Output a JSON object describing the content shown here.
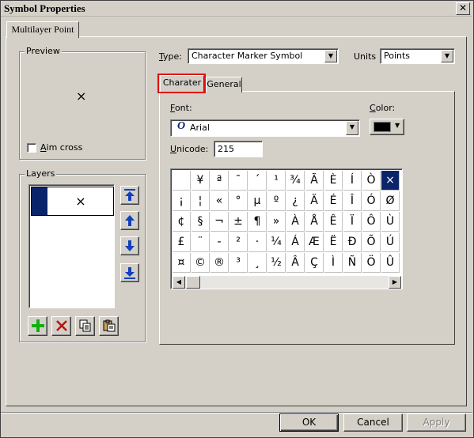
{
  "window": {
    "title": "Symbol Properties",
    "close_glyph": "✕"
  },
  "outer_tab": {
    "label": "Multilayer Point"
  },
  "preview": {
    "label": "Preview",
    "glyph": "×",
    "aim_cross_label": "Aim cross",
    "aim_cross_checked": false
  },
  "layers": {
    "label": "Layers",
    "items": [
      {
        "glyph": "×",
        "swatch_color": "#0a246a"
      }
    ],
    "move_buttons": [
      "move-to-top-icon",
      "move-up-icon",
      "move-down-icon",
      "move-to-bottom-icon"
    ],
    "tool_buttons": [
      "add-icon",
      "delete-icon",
      "copy-icon",
      "paste-icon"
    ]
  },
  "type": {
    "label": "Type:",
    "value": "Character Marker Symbol"
  },
  "units": {
    "label": "Units",
    "value": "Points"
  },
  "inner_tabs": [
    {
      "label": "Charater",
      "active": true
    },
    {
      "label": "General",
      "active": false
    }
  ],
  "font": {
    "label": "Font:",
    "value": "Arial",
    "icon": "opentype-font-icon"
  },
  "color": {
    "label": "Color:",
    "swatch": "#000000"
  },
  "unicode": {
    "label": "Unicode:",
    "value": "215"
  },
  "char_grid": {
    "selected": "×",
    "rows": [
      [
        "",
        "¥",
        "ª",
        "¯",
        "´",
        "¹",
        "¾",
        "Ã",
        "È",
        "Í",
        "Ò",
        "×"
      ],
      [
        "¡",
        "¦",
        "«",
        "°",
        "µ",
        "º",
        "¿",
        "Ä",
        "É",
        "Î",
        "Ó",
        "Ø"
      ],
      [
        "¢",
        "§",
        "¬",
        "±",
        "¶",
        "»",
        "À",
        "Å",
        "Ê",
        "Ï",
        "Ô",
        "Ù"
      ],
      [
        "£",
        "¨",
        "-",
        "²",
        "·",
        "¼",
        "Á",
        "Æ",
        "Ë",
        "Ð",
        "Õ",
        "Ú"
      ],
      [
        "¤",
        "©",
        "®",
        "³",
        "¸",
        "½",
        "Â",
        "Ç",
        "Ì",
        "Ñ",
        "Ö",
        "Û"
      ]
    ]
  },
  "buttons": {
    "ok": "OK",
    "cancel": "Cancel",
    "apply": "Apply"
  }
}
